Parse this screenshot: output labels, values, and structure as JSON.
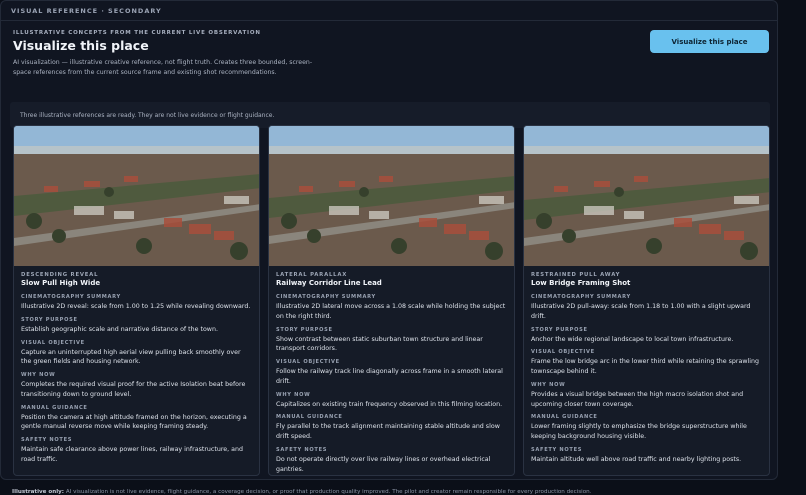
{
  "topbar": {
    "title": "VISUAL REFERENCE · SECONDARY"
  },
  "header": {
    "eyebrow": "ILLUSTRATIVE CONCEPTS FROM THE CURRENT LIVE OBSERVATION",
    "title": "Visualize this place",
    "subtitle": "AI visualization — illustrative creative reference, not flight truth. Creates three bounded, screen-space references from the current source frame and existing shot recommendations.",
    "cta_label": "Visualize this place"
  },
  "notice": "Three illustrative references are ready. They are not live evidence or flight guidance.",
  "labels": {
    "summary": "CINEMATOGRAPHY SUMMARY",
    "purpose": "STORY PURPOSE",
    "objective": "VISUAL OBJECTIVE",
    "why": "WHY NOW",
    "guidance": "MANUAL GUIDANCE",
    "safety": "SAFETY NOTES"
  },
  "cards": [
    {
      "kicker": "DESCENDING REVEAL",
      "title": "Slow Pull High Wide",
      "summary": "Illustrative 2D reveal: scale from 1.00 to 1.25 while revealing downward.",
      "purpose": "Establish geographic scale and narrative distance of the town.",
      "objective": "Capture an uninterrupted high aerial view pulling back smoothly over the green fields and housing network.",
      "why": "Completes the required visual proof for the active Isolation beat before transitioning down to ground level.",
      "guidance": "Position the camera at high altitude framed on the horizon, executing a gentle manual reverse move while keeping framing steady.",
      "safety": "Maintain safe clearance above power lines, railway infrastructure, and road traffic."
    },
    {
      "kicker": "LATERAL PARALLAX",
      "title": "Railway Corridor Line Lead",
      "summary": "Illustrative 2D lateral move across a 1.08 scale while holding the subject on the right third.",
      "purpose": "Show contrast between static suburban town structure and linear transport corridors.",
      "objective": "Follow the railway track line diagonally across frame in a smooth lateral drift.",
      "why": "Capitalizes on existing train frequency observed in this filming location.",
      "guidance": "Fly parallel to the track alignment maintaining stable altitude and slow drift speed.",
      "safety": "Do not operate directly over live railway lines or overhead electrical gantries."
    },
    {
      "kicker": "RESTRAINED PULL AWAY",
      "title": "Low Bridge Framing Shot",
      "summary": "Illustrative 2D pull-away: scale from 1.18 to 1.00 with a slight upward drift.",
      "purpose": "Anchor the wide regional landscape to local town infrastructure.",
      "objective": "Frame the low bridge arc in the lower third while retaining the sprawling townscape behind it.",
      "why": "Provides a visual bridge between the high macro isolation shot and upcoming closer town coverage.",
      "guidance": "Lower framing slightly to emphasize the bridge superstructure while keeping background housing visible.",
      "safety": "Maintain altitude well above road traffic and nearby lighting posts."
    }
  ],
  "footer": {
    "lead": "Illustrative only:",
    "text": "AI visualization is not live evidence, flight guidance, a coverage decision, or proof that production quality improved. The pilot and creator remain responsible for every production decision."
  }
}
